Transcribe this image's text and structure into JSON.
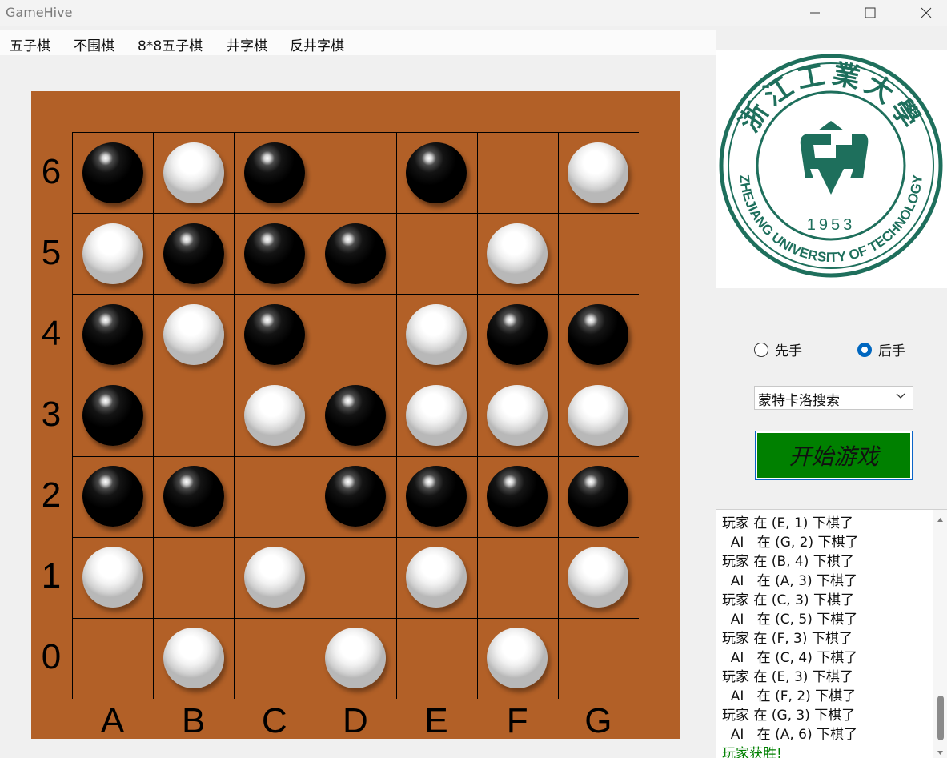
{
  "window": {
    "title": "GameHive"
  },
  "menu": [
    "五子棋",
    "不围棋",
    "8*8五子棋",
    "井字棋",
    "反井字棋"
  ],
  "board": {
    "columns": [
      "A",
      "B",
      "C",
      "D",
      "E",
      "F",
      "G"
    ],
    "rows": [
      "6",
      "5",
      "4",
      "3",
      "2",
      "1",
      "0"
    ],
    "grid": [
      [
        "black",
        "white",
        "black",
        "",
        "black",
        "",
        "white"
      ],
      [
        "white",
        "black",
        "black",
        "black",
        "",
        "white",
        ""
      ],
      [
        "black",
        "white",
        "black",
        "",
        "white",
        "black",
        "black"
      ],
      [
        "black",
        "",
        "white",
        "black",
        "white",
        "white",
        "white"
      ],
      [
        "black",
        "black",
        "",
        "black",
        "black",
        "black",
        "black"
      ],
      [
        "white",
        "",
        "white",
        "",
        "white",
        "",
        "white"
      ],
      [
        "",
        "white",
        "",
        "white",
        "",
        "white",
        ""
      ]
    ]
  },
  "logo": {
    "text_cn": "浙江工業大學",
    "text_en": "ZHEJIANG UNIVERSITY OF TECHNOLOGY",
    "year": "1953",
    "color": "#1e6f5c"
  },
  "controls": {
    "first_label": "先手",
    "second_label": "后手",
    "selected": "second",
    "algorithm": "蒙特卡洛搜索",
    "start_label": "开始游戏"
  },
  "log": [
    "玩家 在 (E, 1) 下棋了",
    "  AI   在 (G, 2) 下棋了",
    "玩家 在 (B, 4) 下棋了",
    "  AI   在 (A, 3) 下棋了",
    "玩家 在 (C, 3) 下棋了",
    "  AI   在 (C, 5) 下棋了",
    "玩家 在 (F, 3) 下棋了",
    "  AI   在 (C, 4) 下棋了",
    "玩家 在 (E, 3) 下棋了",
    "  AI   在 (F, 2) 下棋了",
    "玩家 在 (G, 3) 下棋了",
    "  AI   在 (A, 6) 下棋了"
  ],
  "result": "玩家获胜!",
  "colors": {
    "board": "#b26027",
    "start": "#008000",
    "win": "#008000",
    "radio": "#0067c0"
  }
}
